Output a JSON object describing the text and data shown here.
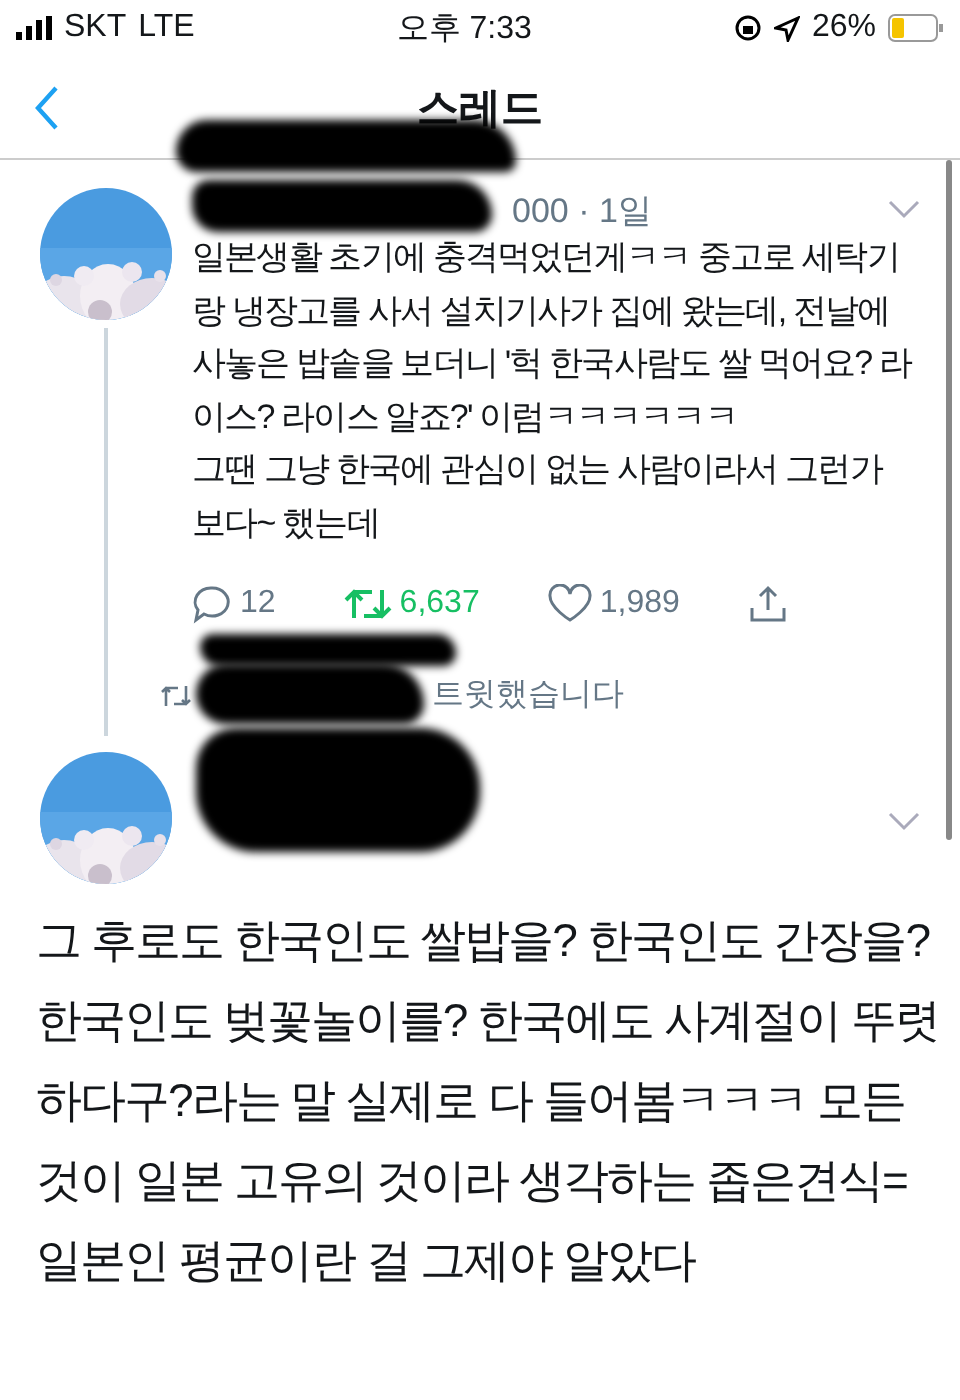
{
  "status_bar": {
    "carrier": "SKT",
    "network": "LTE",
    "time": "오후 7:33",
    "battery": "26%"
  },
  "nav": {
    "title": "스레드"
  },
  "parent_tweet": {
    "meta": "000 · 1일",
    "text": "일본생활 초기에 충격먹었던게ㅋㅋ 중고로 세탁기랑 냉장고를 사서 설치기사가 집에 왔는데, 전날에 사놓은 밥솥을 보더니 '헉 한국사람도 쌀 먹어요? 라이스? 라이스 알죠?' 이럼ㅋㅋㅋㅋㅋㅋ\n그땐 그냥 한국에 관심이 없는 사람이라서 그런가 보다~ 했는데",
    "replies": "12",
    "retweets": "6,637",
    "retweeted": true,
    "likes": "1,989",
    "liked": false,
    "retweet_note": "트윗했습니다"
  },
  "main_tweet": {
    "text": "그 후로도 한국인도 쌀밥을? 한국인도 간장을? 한국인도 벚꽃놀이를? 한국에도 사계절이 뚜렷하다구?라는 말 실제로 다 들어봄ㅋㅋㅋ 모든것이 일본 고유의 것이라 생각하는 좁은견식=일본인 평균이란 걸 그제야 알았다"
  }
}
